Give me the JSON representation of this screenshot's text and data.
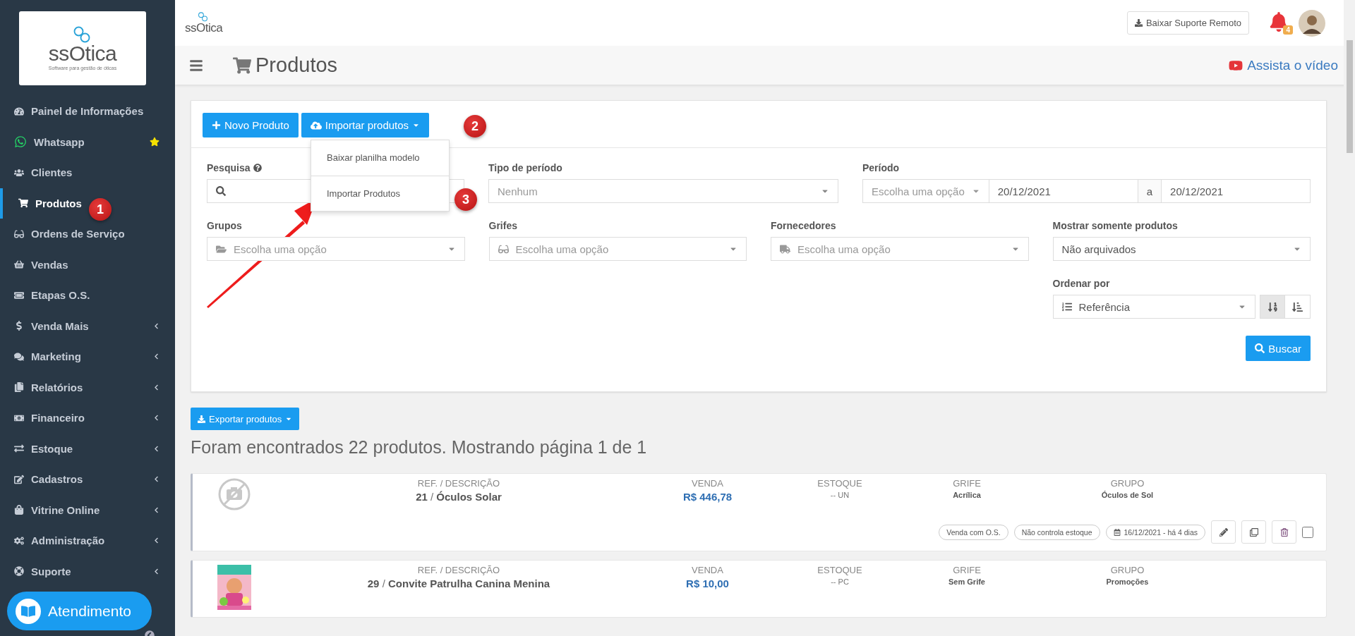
{
  "sidebar": {
    "logo": {
      "name": "ssOtica",
      "tagline": "Software para gestão de óticas"
    },
    "items": [
      {
        "label": "Painel de Informações",
        "selected": false,
        "submenu": false,
        "starred": false
      },
      {
        "label": "Whatsapp",
        "selected": false,
        "submenu": false,
        "starred": true
      },
      {
        "label": "Clientes",
        "selected": false,
        "submenu": false,
        "starred": false
      },
      {
        "label": "Produtos",
        "selected": true,
        "submenu": false,
        "starred": false
      },
      {
        "label": "Ordens de Serviço",
        "selected": false,
        "submenu": false,
        "starred": false
      },
      {
        "label": "Vendas",
        "selected": false,
        "submenu": false,
        "starred": false
      },
      {
        "label": "Etapas O.S.",
        "selected": false,
        "submenu": false,
        "starred": false
      },
      {
        "label": "Venda Mais",
        "selected": false,
        "submenu": true,
        "starred": false
      },
      {
        "label": "Marketing",
        "selected": false,
        "submenu": true,
        "starred": false
      },
      {
        "label": "Relatórios",
        "selected": false,
        "submenu": true,
        "starred": false
      },
      {
        "label": "Financeiro",
        "selected": false,
        "submenu": true,
        "starred": false
      },
      {
        "label": "Estoque",
        "selected": false,
        "submenu": true,
        "starred": false
      },
      {
        "label": "Cadastros",
        "selected": false,
        "submenu": true,
        "starred": false
      },
      {
        "label": "Vitrine Online",
        "selected": false,
        "submenu": true,
        "starred": false
      },
      {
        "label": "Administração",
        "selected": false,
        "submenu": true,
        "starred": false
      },
      {
        "label": "Suporte",
        "selected": false,
        "submenu": true,
        "starred": false
      }
    ],
    "chat_button": "Atendimento"
  },
  "header": {
    "logo": "ssOtica",
    "remote_button": "Baixar Suporte Remoto",
    "notification_count": "4"
  },
  "page": {
    "title": "Produtos",
    "video_link": "Assista o vídeo"
  },
  "toolbar": {
    "buttons": [
      {
        "label": "Novo Produto",
        "kind": "new"
      },
      {
        "label": "Importar produtos",
        "kind": "dropdown"
      }
    ],
    "menu": [
      {
        "label": "Baixar planilha modelo"
      },
      {
        "label": "Importar Produtos"
      }
    ]
  },
  "annotations": [
    {
      "number": "1"
    },
    {
      "number": "2"
    },
    {
      "number": "3"
    }
  ],
  "filters": {
    "row_1": [
      {
        "kind": "search",
        "label": "Pesquisa"
      },
      {
        "kind": "select",
        "label": "Tipo de período",
        "placeholder": "Nenhum"
      },
      {
        "kind": "period",
        "label": "Período",
        "placeholder": "Escolha uma opção",
        "from": "20/12/2021",
        "separator": "a",
        "to": "20/12/2021"
      }
    ],
    "row_2": [
      {
        "kind": "select",
        "label": "Grupos",
        "placeholder": "Escolha uma opção"
      },
      {
        "kind": "select",
        "label": "Grifes",
        "placeholder": "Escolha uma opção"
      },
      {
        "kind": "select",
        "label": "Fornecedores",
        "placeholder": "Escolha uma opção"
      },
      {
        "kind": "select",
        "label": "Mostrar somente produtos",
        "value": "Não arquivados"
      }
    ],
    "order": {
      "label": "Ordenar por",
      "value": "Referência",
      "directions": [
        {
          "selected": true
        },
        {
          "selected": false
        }
      ]
    },
    "search_button": "Buscar"
  },
  "results": {
    "export_button": "Exportar produtos",
    "summary": "Foram encontrados 22 produtos. Mostrando página 1 de 1",
    "products": [
      {
        "image": {
          "kind": "placeholder"
        },
        "cells": [
          {
            "kind": "ref",
            "heading": "REF. / DESCRIÇÃO",
            "ref": "21",
            "separator": "/",
            "description": "Óculos Solar"
          },
          {
            "kind": "price",
            "heading": "VENDA",
            "value": "R$ 446,78"
          },
          {
            "kind": "stock",
            "heading": "ESTOQUE",
            "value": "-- UN"
          },
          {
            "kind": "text",
            "heading": "GRIFE",
            "value": "Acrílica"
          },
          {
            "kind": "text",
            "heading": "GRUPO",
            "value": "Óculos de Sol"
          }
        ],
        "tags": [
          "Venda com O.S.",
          "Não controla estoque"
        ],
        "date": "16/12/2021 - há 4 dias",
        "checked": false
      },
      {
        "cells": [
          {
            "kind": "ref",
            "heading": "REF. / DESCRIÇÃO",
            "ref": "29",
            "separator": "/",
            "description": "Convite Patrulha Canina Menina"
          },
          {
            "kind": "price",
            "heading": "VENDA",
            "value": "R$ 10,00"
          },
          {
            "kind": "stock",
            "heading": "ESTOQUE",
            "value": "-- PC"
          },
          {
            "kind": "text",
            "heading": "GRIFE",
            "value": "Sem Grife"
          },
          {
            "kind": "text",
            "heading": "GRUPO",
            "value": "Promoções"
          }
        ]
      }
    ]
  }
}
